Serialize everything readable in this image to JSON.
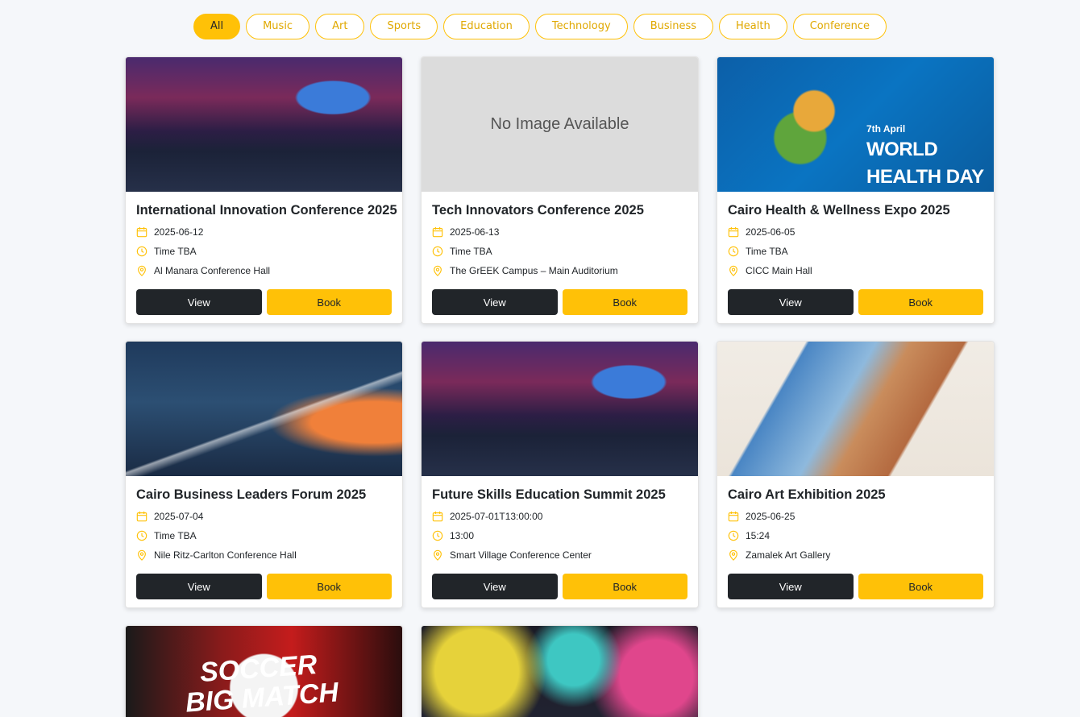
{
  "filters": [
    "All",
    "Music",
    "Art",
    "Sports",
    "Education",
    "Technology",
    "Business",
    "Health",
    "Conference"
  ],
  "active_filter": "All",
  "buttons": {
    "view": "View",
    "book": "Book"
  },
  "no_image_text": "No Image Available",
  "events": [
    {
      "title": "International Innovation Conference 2025",
      "date": "2025-06-12",
      "time": "Time TBA",
      "venue": "Al Manara Conference Hall"
    },
    {
      "title": "Tech Innovators Conference 2025",
      "date": "2025-06-13",
      "time": "Time TBA",
      "venue": "The GrEEK Campus – Main Auditorium"
    },
    {
      "title": "Cairo Health & Wellness Expo 2025",
      "date": "2025-06-05",
      "time": "Time TBA",
      "venue": "CICC Main Hall",
      "image_text": {
        "date": "7th April",
        "line1": "WORLD",
        "line2": "HEALTH DAY"
      }
    },
    {
      "title": "Cairo Business Leaders Forum 2025",
      "date": "2025-07-04",
      "time": "Time TBA",
      "venue": "Nile Ritz-Carlton Conference Hall"
    },
    {
      "title": "Future Skills Education Summit 2025",
      "date": "2025-07-01T13:00:00",
      "time": "13:00",
      "venue": "Smart Village Conference Center"
    },
    {
      "title": "Cairo Art Exhibition 2025",
      "date": "2025-06-25",
      "time": "15:24",
      "venue": "Zamalek Art Gallery"
    },
    {
      "image_text": {
        "line1": "SOCCER",
        "line2": "BIG MATCH"
      }
    },
    {}
  ],
  "colors": {
    "accent": "#ffc107",
    "dark": "#212529",
    "background": "#f5f7fa"
  }
}
